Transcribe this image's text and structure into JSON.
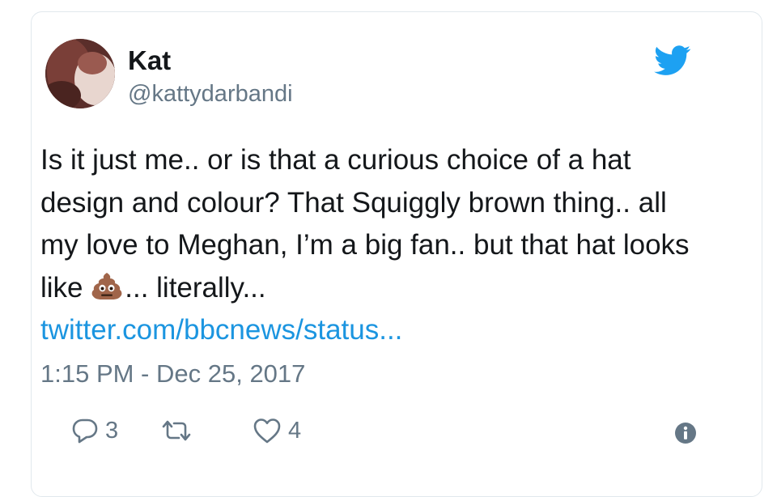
{
  "tweet": {
    "author": {
      "name": "Kat",
      "handle": "@kattydarbandi",
      "avatar_icon": "avatar-photo"
    },
    "text_before_emoji": "Is it just me.. or is that a curious choice of a hat design and colour? That Squiggly brown thing.. all my love to Meghan, I’m a big fan.. but that hat looks like ",
    "emoji": "pile-of-poo-emoji",
    "text_after_emoji": "... literally...",
    "link": "twitter.com/bbcnews/status...",
    "timestamp": "1:15 PM - Dec 25, 2017",
    "actions": {
      "reply_count": "3",
      "retweet_count": "",
      "like_count": "4"
    }
  },
  "icons": {
    "brand": "twitter-bird-icon",
    "reply": "reply-icon",
    "retweet": "retweet-icon",
    "like": "heart-icon",
    "info": "info-icon"
  },
  "colors": {
    "link": "#1b95e0",
    "brand": "#1da1f2",
    "secondary_text": "#657786",
    "primary_text": "#14171a",
    "border": "#e1e8ed"
  }
}
